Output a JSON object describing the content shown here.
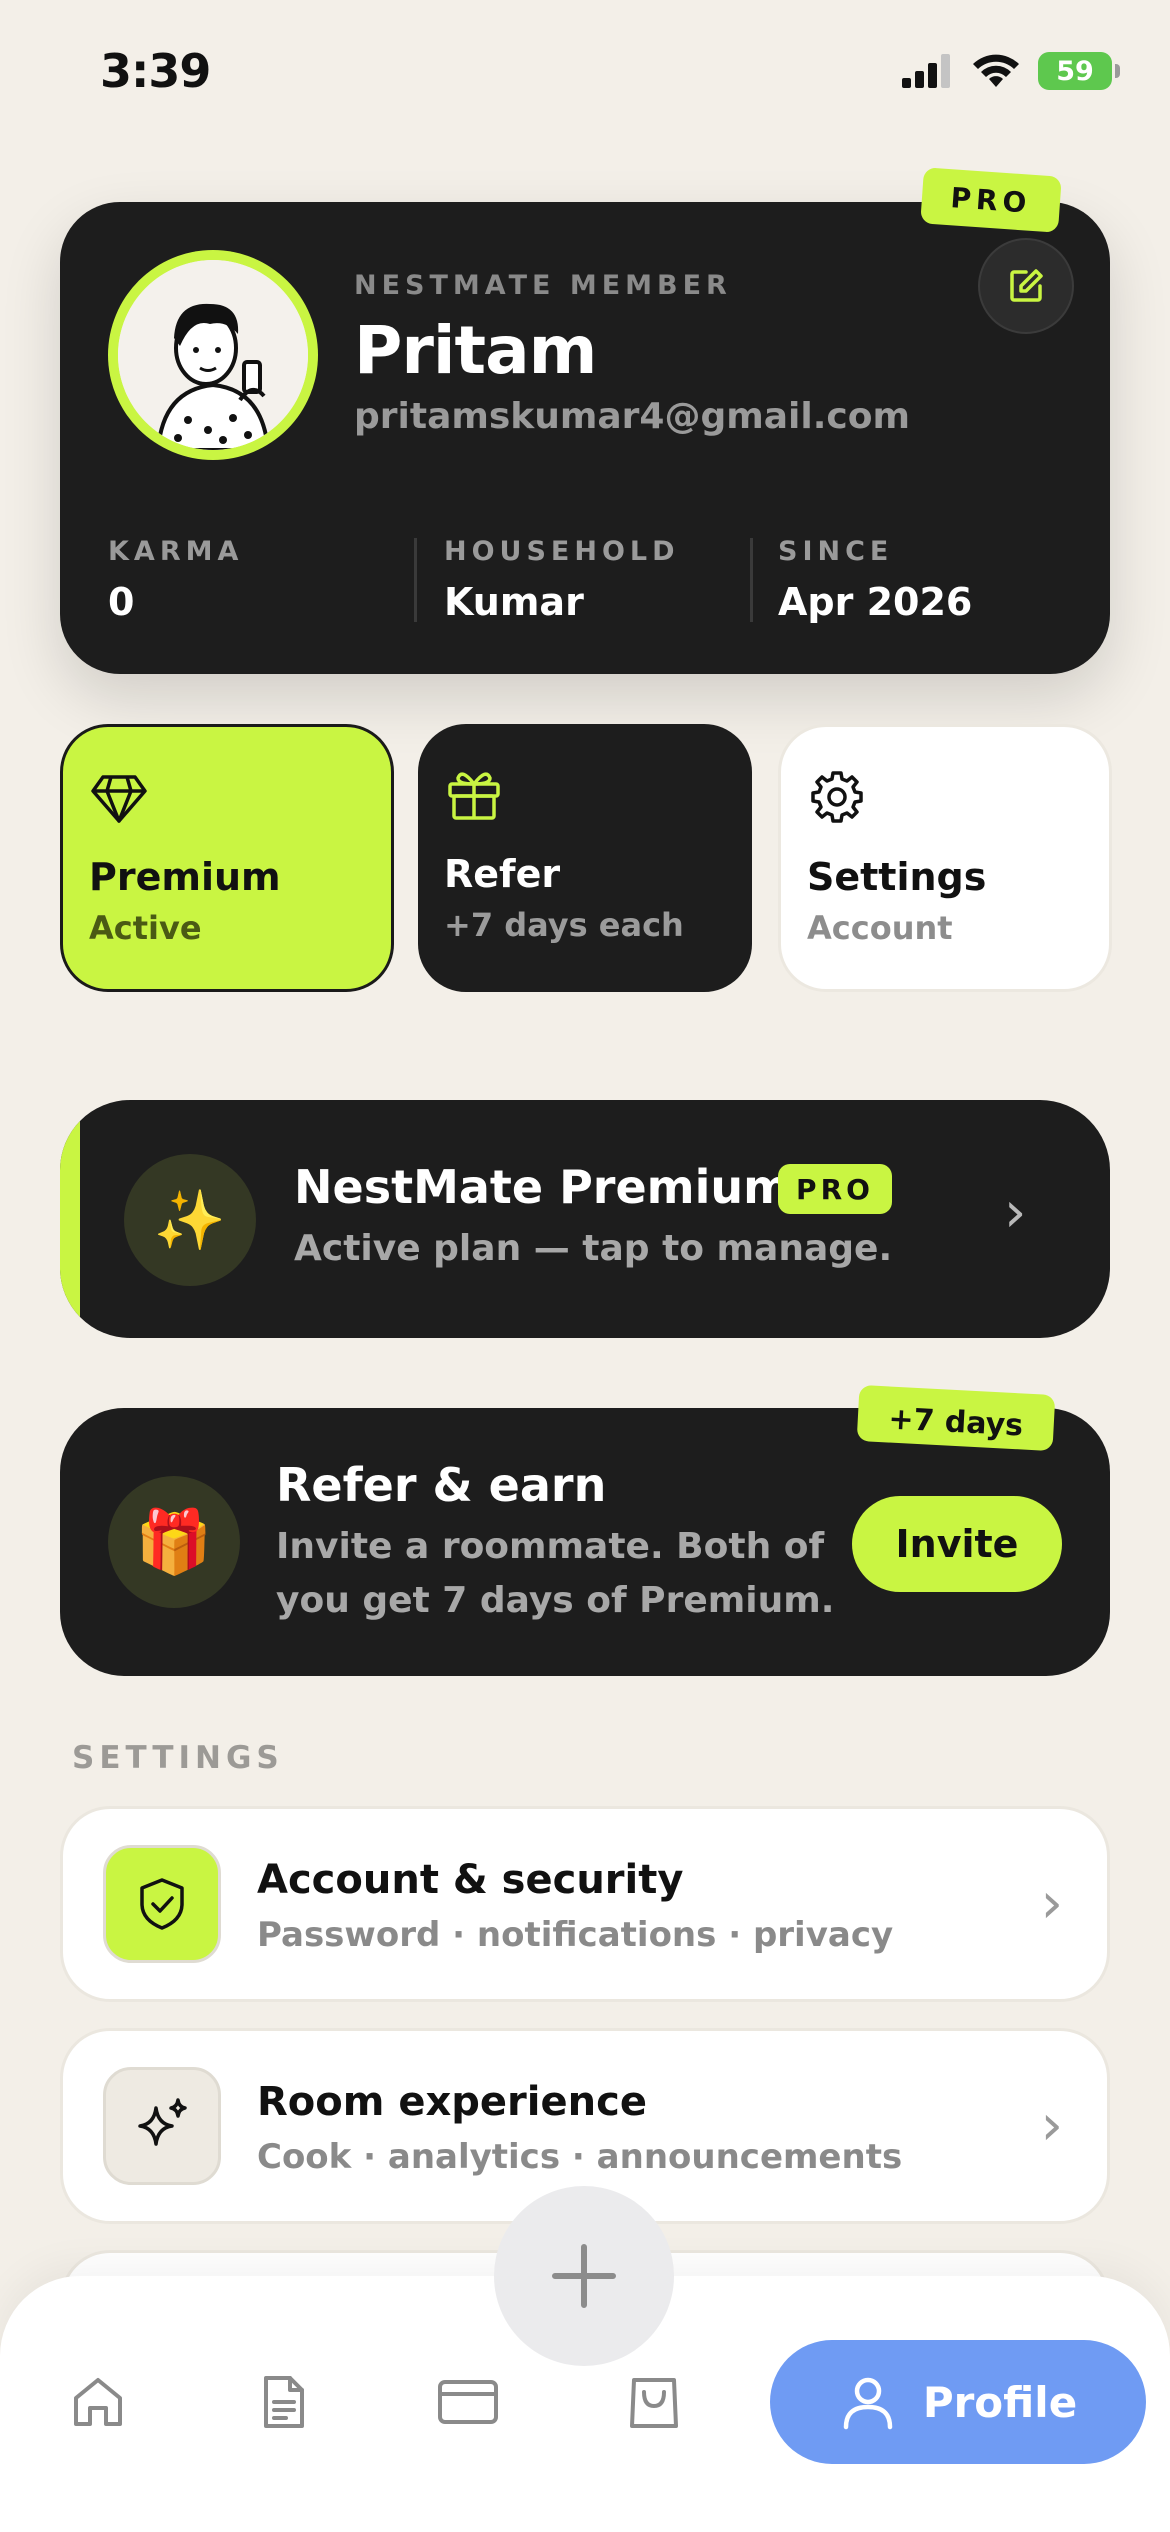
{
  "status_bar": {
    "time": "3:39",
    "battery": "59"
  },
  "profile": {
    "pro_tag": "PRO",
    "member_label": "NESTMATE MEMBER",
    "name": "Pritam",
    "email": "pritamskumar4@gmail.com",
    "stats": [
      {
        "label": "KARMA",
        "value": "0"
      },
      {
        "label": "HOUSEHOLD",
        "value": "Kumar"
      },
      {
        "label": "SINCE",
        "value": "Apr 2026"
      }
    ]
  },
  "tiles": [
    {
      "title": "Premium",
      "sub": "Active",
      "icon": "diamond-icon"
    },
    {
      "title": "Refer",
      "sub": "+7 days each",
      "icon": "gift-icon"
    },
    {
      "title": "Settings",
      "sub": "Account",
      "icon": "gear-icon"
    }
  ],
  "premium_banner": {
    "emoji": "✨",
    "title": "NestMate Premium",
    "pill": "PRO",
    "sub": "Active plan — tap to manage."
  },
  "refer_card": {
    "tag": "+7 days",
    "emoji": "🎁",
    "title": "Refer & earn",
    "sub": "Invite a roommate. Both of you get 7 days of Premium.",
    "button": "Invite"
  },
  "settings": {
    "section_label": "SETTINGS",
    "rows": [
      {
        "title": "Account & security",
        "sub": "Password · notifications · privacy",
        "icon": "shield-check-icon"
      },
      {
        "title": "Room experience",
        "sub": "Cook · analytics · announcements",
        "icon": "sparkles-icon"
      }
    ]
  },
  "nav": {
    "items": [
      "home-icon",
      "document-icon",
      "card-icon",
      "bag-icon"
    ],
    "active_label": "Profile"
  },
  "colors": {
    "accent": "#c9f542",
    "dark": "#1d1d1d",
    "nav_active": "#6f9bf3",
    "background": "#f3efe8"
  }
}
